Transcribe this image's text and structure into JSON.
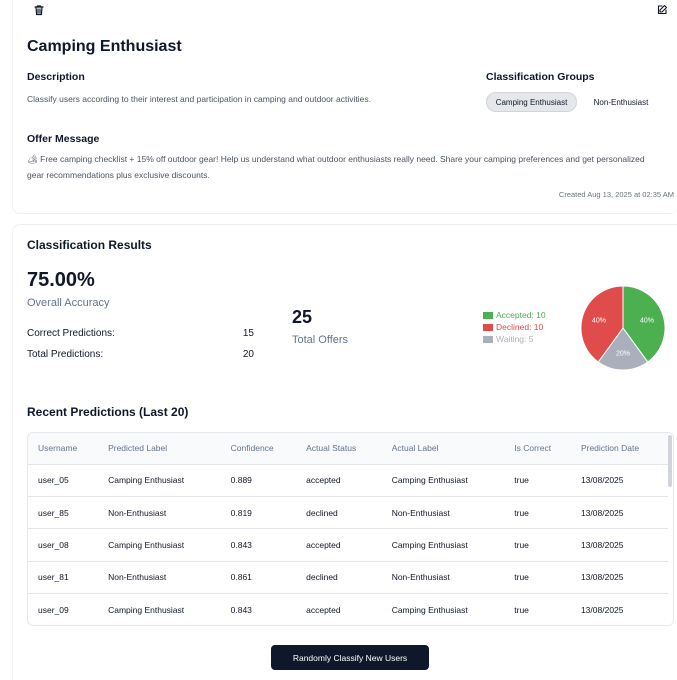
{
  "header": {
    "delete_icon": "trash-icon",
    "edit_icon": "edit-icon"
  },
  "profile": {
    "title": "Camping Enthusiast",
    "description_heading": "Description",
    "description": "Classify users according to their interest and participation in camping and outdoor activities.",
    "groups_heading": "Classification Groups",
    "groups": [
      "Camping Enthusiast",
      "Non-Enthusiast"
    ],
    "selected_group": "Camping Enthusiast",
    "offer_heading": "Offer Message",
    "offer_line1": "🏕 Free camping checklist + 15% off outdoor gear! Help us understand what outdoor enthusiasts really need. Share your camping preferences and get personalized",
    "offer_line2": "gear recommendations plus exclusive discounts.",
    "created": "Created Aug 13, 2025 at 02:35 AM"
  },
  "results": {
    "heading": "Classification Results",
    "accuracy_value": "75.00%",
    "accuracy_label": "Overall Accuracy",
    "correct_label": "Correct Predictions:",
    "correct_value": "15",
    "total_label": "Total Predictions:",
    "total_value": "20",
    "offers_value": "25",
    "offers_label": "Total Offers",
    "legend": [
      {
        "label": "Accepted: 10",
        "color": "#4caf50"
      },
      {
        "label": "Declined: 10",
        "color": "#e04b4b"
      },
      {
        "label": "Waiting: 5",
        "color": "#aab0bb"
      }
    ],
    "pie": [
      {
        "name": "Accepted",
        "value": 10,
        "label": "40%",
        "color": "#4caf50"
      },
      {
        "name": "Waiting",
        "value": 5,
        "label": "20%",
        "color": "#aab0bb"
      },
      {
        "name": "Declined",
        "value": 10,
        "label": "40%",
        "color": "#e04b4b"
      }
    ]
  },
  "recent": {
    "heading": "Recent Predictions (Last 20)",
    "columns": [
      "Username",
      "Predicted Label",
      "Confidence",
      "Actual Status",
      "Actual Label",
      "Is Correct",
      "Prediction Date"
    ],
    "rows": [
      [
        "user_05",
        "Camping Enthusiast",
        "0.889",
        "accepted",
        "Camping Enthusiast",
        "true",
        "13/08/2025"
      ],
      [
        "user_85",
        "Non-Enthusiast",
        "0.819",
        "declined",
        "Non-Enthusiast",
        "true",
        "13/08/2025"
      ],
      [
        "user_08",
        "Camping Enthusiast",
        "0.843",
        "accepted",
        "Camping Enthusiast",
        "true",
        "13/08/2025"
      ],
      [
        "user_81",
        "Non-Enthusiast",
        "0.861",
        "declined",
        "Non-Enthusiast",
        "true",
        "13/08/2025"
      ],
      [
        "user_09",
        "Camping Enthusiast",
        "0.843",
        "accepted",
        "Camping Enthusiast",
        "true",
        "13/08/2025"
      ]
    ]
  },
  "actions": {
    "classify_label": "Randomly Classify New Users"
  }
}
